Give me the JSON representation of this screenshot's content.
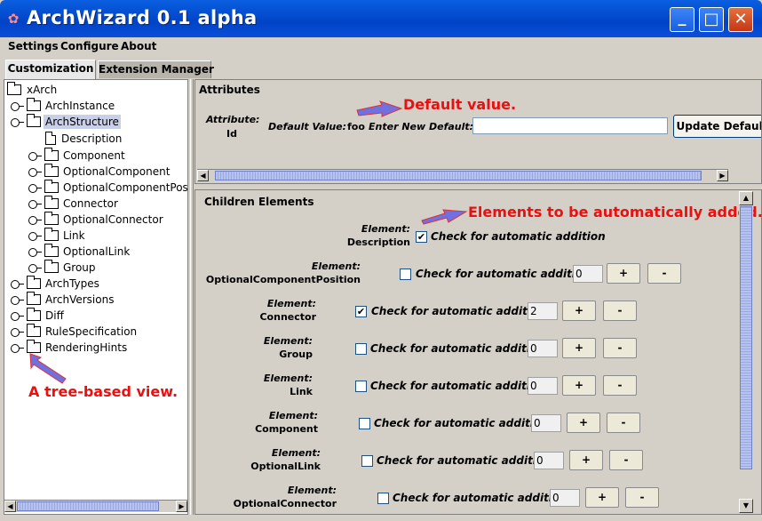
{
  "window": {
    "title": "ArchWizard 0.1 alpha",
    "minimize": "_",
    "maximize": "□",
    "close": "✕",
    "app_icon": "app-logo-icon"
  },
  "menu": [
    "Settings",
    "Configure",
    "About"
  ],
  "tabs": [
    {
      "label": "Customization",
      "active": true
    },
    {
      "label": "Extension Manager",
      "active": false
    }
  ],
  "tree": [
    {
      "label": "xArch"
    },
    {
      "label": "ArchInstance"
    },
    {
      "label": "ArchStructure",
      "selected": true
    },
    {
      "label": "Description"
    },
    {
      "label": "Component"
    },
    {
      "label": "OptionalComponent"
    },
    {
      "label": "OptionalComponentPosition"
    },
    {
      "label": "Connector"
    },
    {
      "label": "OptionalConnector"
    },
    {
      "label": "Link"
    },
    {
      "label": "OptionalLink"
    },
    {
      "label": "Group"
    },
    {
      "label": "ArchTypes"
    },
    {
      "label": "ArchVersions"
    },
    {
      "label": "Diff"
    },
    {
      "label": "RuleSpecification"
    },
    {
      "label": "RenderingHints"
    }
  ],
  "attributes": {
    "section_title": "Attributes",
    "attribute_label": "Attribute:",
    "attribute_name": "Id",
    "default_value_label": "Default Value:",
    "default_value": "foo",
    "enter_new_default_label": "Enter New Default:",
    "new_default_value": "",
    "update_button": "Update Default"
  },
  "children": {
    "section_title": "Children Elements",
    "element_label": "Element:",
    "check_label": "Check for automatic addition",
    "plus": "+",
    "minus": "-",
    "rows": [
      {
        "name": "Description",
        "checked": true,
        "count": null
      },
      {
        "name": "OptionalComponentPosition",
        "checked": false,
        "count": "0"
      },
      {
        "name": "Connector",
        "checked": true,
        "count": "2"
      },
      {
        "name": "Group",
        "checked": false,
        "count": "0"
      },
      {
        "name": "Link",
        "checked": false,
        "count": "0"
      },
      {
        "name": "Component",
        "checked": false,
        "count": "0"
      },
      {
        "name": "OptionalLink",
        "checked": false,
        "count": "0"
      },
      {
        "name": "OptionalConnector",
        "checked": false,
        "count": "0"
      }
    ]
  },
  "annotations": {
    "default_value": "Default value.",
    "elements_added": "Elements to be automatically added.",
    "tree_view": "A tree-based view."
  },
  "colors": {
    "annotation": "#e81010",
    "titlebar": "#0a5fe0",
    "selection": "#c8cfe8"
  }
}
